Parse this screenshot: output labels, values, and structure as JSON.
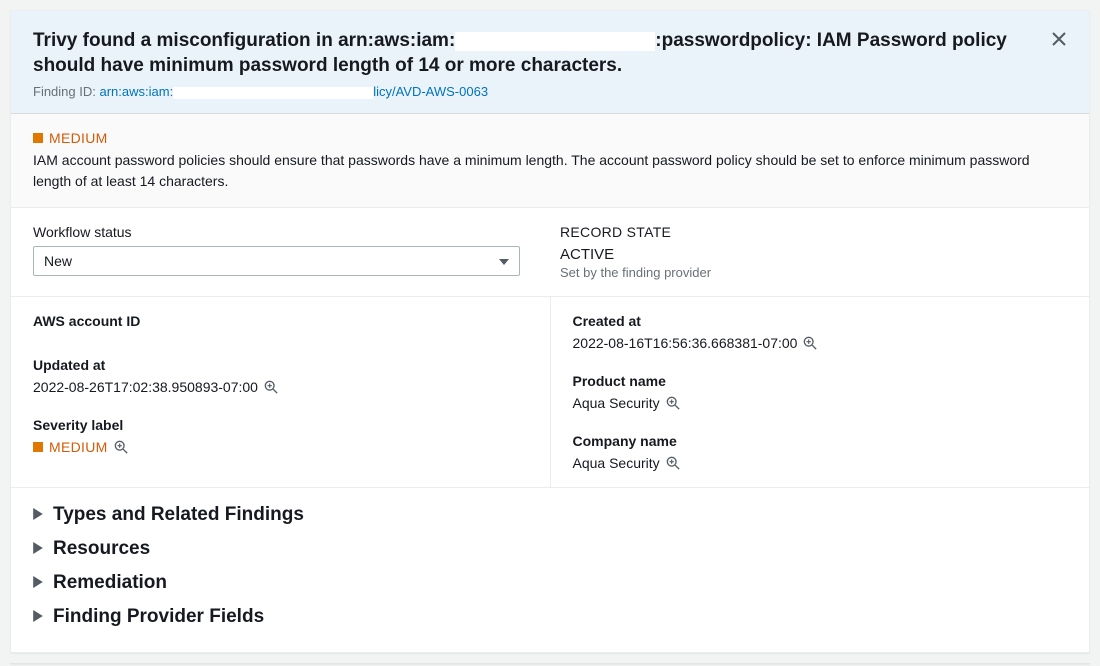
{
  "header": {
    "title_prefix": "Trivy found a misconfiguration in arn:aws:iam:",
    "title_suffix": ":passwordpolicy: IAM Password policy should have minimum password length of 14 or more characters.",
    "finding_id_label": "Finding ID: ",
    "finding_id_link1": "arn:aws:iam:",
    "finding_id_link2": "licy/AVD-AWS-0063"
  },
  "severity": {
    "label": "MEDIUM",
    "color": "#d45b07"
  },
  "description": "IAM account password policies should ensure that passwords have a minimum length. The account password policy should be set to enforce minimum password length of at least 14 characters.",
  "workflow": {
    "label": "Workflow status",
    "value": "New"
  },
  "record_state": {
    "label": "RECORD STATE",
    "value": "ACTIVE",
    "note": "Set by the finding provider"
  },
  "fields": {
    "aws_account_id": {
      "label": "AWS account ID",
      "value": ""
    },
    "created_at": {
      "label": "Created at",
      "value": "2022-08-16T16:56:36.668381-07:00"
    },
    "updated_at": {
      "label": "Updated at",
      "value": "2022-08-26T17:02:38.950893-07:00"
    },
    "product_name": {
      "label": "Product name",
      "value": "Aqua Security"
    },
    "severity_label": {
      "label": "Severity label",
      "value": "MEDIUM"
    },
    "company_name": {
      "label": "Company name",
      "value": "Aqua Security"
    }
  },
  "expanders": [
    {
      "label": "Types and Related Findings"
    },
    {
      "label": "Resources"
    },
    {
      "label": "Remediation"
    },
    {
      "label": "Finding Provider Fields"
    }
  ]
}
